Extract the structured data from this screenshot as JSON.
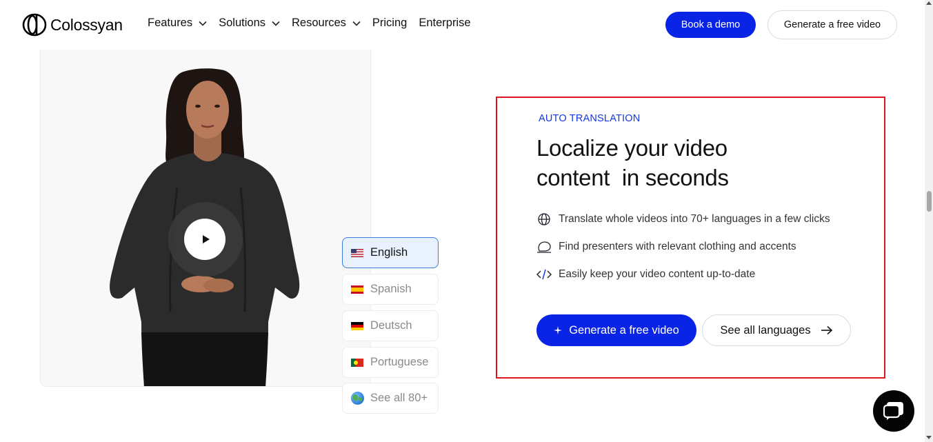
{
  "header": {
    "logo_text": "Colossyan",
    "nav": [
      {
        "label": "Features",
        "has_dropdown": true
      },
      {
        "label": "Solutions",
        "has_dropdown": true
      },
      {
        "label": "Resources",
        "has_dropdown": true
      },
      {
        "label": "Pricing",
        "has_dropdown": false
      },
      {
        "label": "Enterprise",
        "has_dropdown": false
      }
    ],
    "book_demo_label": "Book a demo",
    "generate_free_label": "Generate a free video"
  },
  "video": {
    "play_icon": "play-icon"
  },
  "languages": [
    {
      "label": "English",
      "flag": "us-flag-icon",
      "active": true
    },
    {
      "label": "Spanish",
      "flag": "spain-flag-icon",
      "active": false
    },
    {
      "label": "Deutsch",
      "flag": "germany-flag-icon",
      "active": false
    },
    {
      "label": "Portuguese",
      "flag": "portugal-flag-icon",
      "active": false
    },
    {
      "label": "See all 80+",
      "flag": "globe-icon",
      "active": false
    }
  ],
  "feature": {
    "eyebrow": "AUTO TRANSLATION",
    "headline_line1": "Localize your video",
    "headline_line2": "content  in seconds",
    "bullets": [
      {
        "icon": "globe-outline-icon",
        "text": "Translate whole videos into 70+ languages in a few clicks"
      },
      {
        "icon": "presenter-icon",
        "text": "Find presenters with relevant clothing and accents"
      },
      {
        "icon": "code-icon",
        "text": "Easily keep your video content up-to-date"
      }
    ],
    "primary_cta": "Generate a free video",
    "secondary_cta": "See all languages"
  },
  "colors": {
    "brand_blue": "#0a24e6",
    "highlight_border": "#e0141e",
    "active_lang_bg": "#e8f1fd"
  }
}
